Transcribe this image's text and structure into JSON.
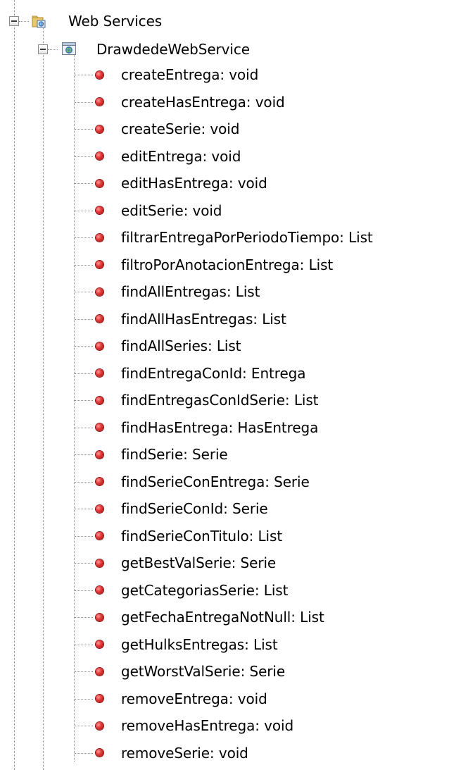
{
  "tree": {
    "root": {
      "label": "Web Services",
      "icon": "folder-web-services-icon"
    },
    "service": {
      "label": "DrawdedeWebService",
      "icon": "web-service-icon"
    },
    "methods": [
      "createEntrega: void",
      "createHasEntrega: void",
      "createSerie: void",
      "editEntrega: void",
      "editHasEntrega: void",
      "editSerie: void",
      "filtrarEntregaPorPeriodoTiempo: List",
      "filtroPorAnotacionEntrega: List",
      "findAllEntregas: List",
      "findAllHasEntregas: List",
      "findAllSeries: List",
      "findEntregaConId: Entrega",
      "findEntregasConIdSerie: List",
      "findHasEntrega: HasEntrega",
      "findSerie: Serie",
      "findSerieConEntrega: Serie",
      "findSerieConId: Serie",
      "findSerieConTitulo: List",
      "getBestValSerie: Serie",
      "getCategoriasSerie: List",
      "getFechaEntregaNotNull: List",
      "getHulksEntregas: List",
      "getWorstValSerie: Serie",
      "removeEntrega: void",
      "removeHasEntrega: void",
      "removeSerie: void"
    ],
    "method_icon": "operation-icon"
  }
}
